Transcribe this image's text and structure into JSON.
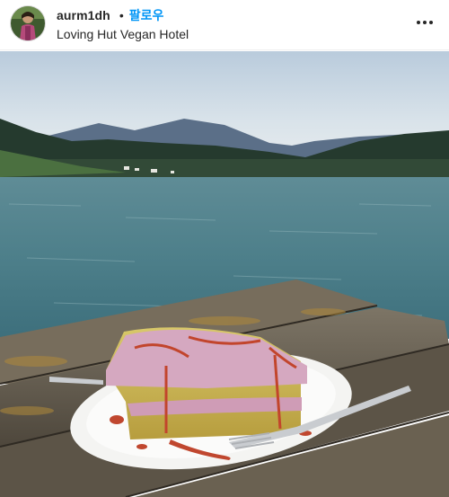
{
  "post": {
    "username": "aurm1dh",
    "separator": "•",
    "follow_label": "팔로우",
    "location": "Loving Hut Vegan Hotel"
  },
  "icons": {
    "more": "more-horizontal-icon",
    "avatar": "profile-avatar"
  },
  "colors": {
    "username": "#262626",
    "follow": "#0095f6"
  }
}
